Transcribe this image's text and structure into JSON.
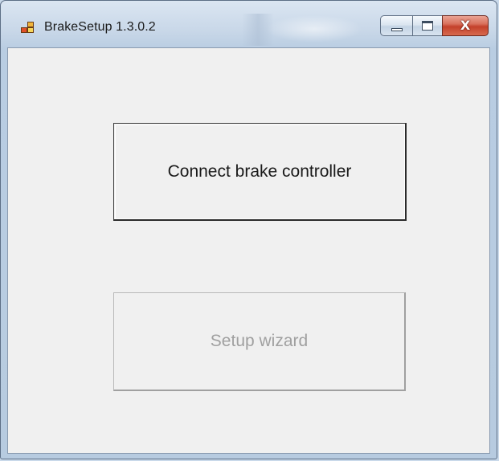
{
  "window": {
    "title": "BrakeSetup 1.3.0.2",
    "icon": "application-icon",
    "caption_buttons": {
      "minimize_icon": "minimize-icon",
      "maximize_icon": "maximize-icon",
      "close_icon": "close-icon",
      "close_glyph": "X"
    },
    "colors": {
      "client_background": "#f0f0f0",
      "close_button": "#c4412b"
    }
  },
  "main": {
    "connect_button": {
      "label": "Connect brake controller",
      "state": "enabled"
    },
    "setup_wizard_button": {
      "label": "Setup wizard",
      "state": "disabled"
    }
  }
}
